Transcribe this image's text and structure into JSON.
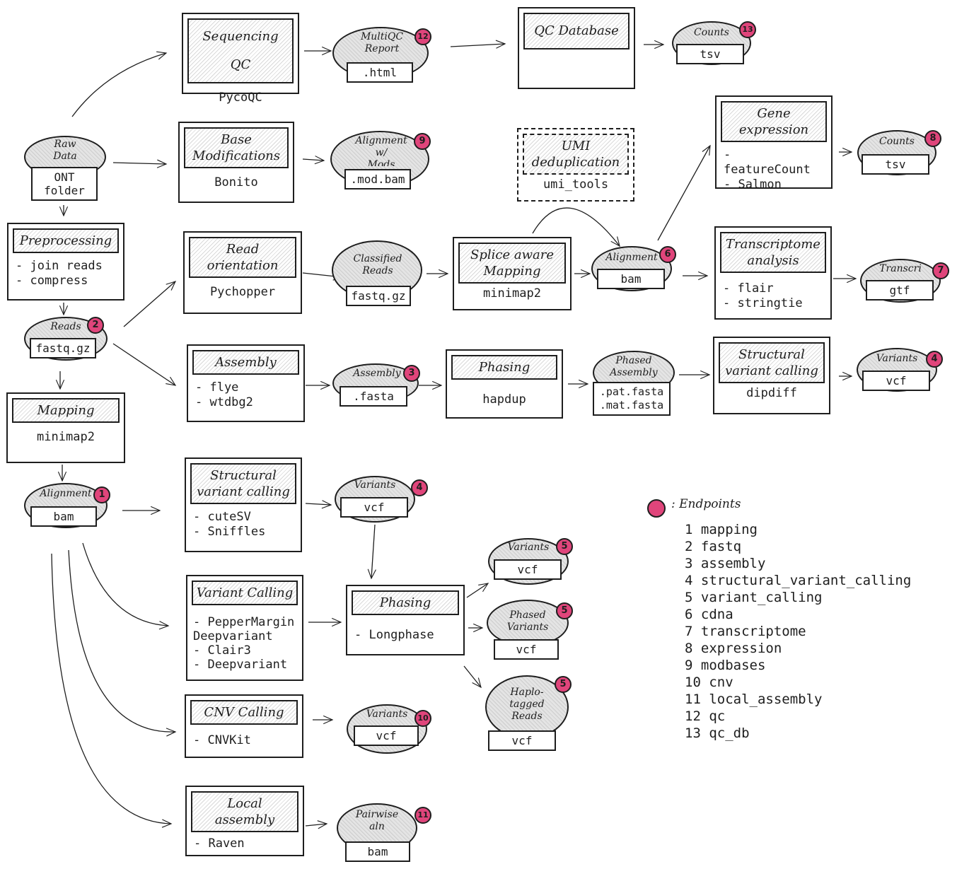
{
  "colors": {
    "endpoint": "#e0457b",
    "ink": "#1e1e1e"
  },
  "processes": [
    {
      "id": "sequencing-qc",
      "title": "Sequencing QC",
      "body": "PycoQC",
      "center": true
    },
    {
      "id": "base-modifications",
      "title": "Base\nModifications",
      "body": "Bonito",
      "center": true
    },
    {
      "id": "preprocessing",
      "title": "Preprocessing",
      "body": "- join reads\n- compress",
      "center": false
    },
    {
      "id": "read-orientation",
      "title": "Read\norientation",
      "body": "Pychopper",
      "center": true
    },
    {
      "id": "assembly",
      "title": "Assembly",
      "body": "- flye\n- wtdbg2",
      "center": false
    },
    {
      "id": "mapping",
      "title": "Mapping",
      "body": "minimap2",
      "center": true
    },
    {
      "id": "qc-database",
      "title": "QC Database",
      "body": "",
      "center": true
    },
    {
      "id": "umi-deduplication",
      "title": "UMI\ndeduplication",
      "body": "umi_tools",
      "center": true,
      "dashed": true
    },
    {
      "id": "splice-aware-mapping",
      "title": "Splice aware\nMapping",
      "body": "minimap2",
      "center": true
    },
    {
      "id": "gene-expression",
      "title": "Gene\nexpression",
      "body": "- featureCount\n- Salmon",
      "center": false
    },
    {
      "id": "transcriptome-analysis",
      "title": "Transcriptome\nanalysis",
      "body": "- flair\n- stringtie",
      "center": false
    },
    {
      "id": "phasing-assembly",
      "title": "Phasing",
      "body": "hapdup",
      "center": true
    },
    {
      "id": "structural-variant-calling-assembly",
      "title": "Structural\nvariant calling",
      "body": "dipdiff",
      "center": true
    },
    {
      "id": "structural-variant-calling",
      "title": "Structural\nvariant calling",
      "body": "- cuteSV\n- Sniffles",
      "center": false
    },
    {
      "id": "variant-calling",
      "title": "Variant Calling",
      "body": "- PepperMargin\nDeepvariant\n- Clair3\n- Deepvariant",
      "center": false
    },
    {
      "id": "phasing",
      "title": "Phasing",
      "body": "- Longphase",
      "center": false
    },
    {
      "id": "cnv-calling",
      "title": "CNV Calling",
      "body": "- CNVKit",
      "center": false
    },
    {
      "id": "local-assembly",
      "title": "Local\nassembly",
      "body": "- Raven",
      "center": false
    }
  ],
  "artifacts": [
    {
      "id": "raw-data",
      "label": "Raw\nData",
      "file": "ONT\nfolder",
      "badge": ""
    },
    {
      "id": "reads",
      "label": "Reads",
      "file": "fastq.gz",
      "badge": "2"
    },
    {
      "id": "alignment-main",
      "label": "Alignment",
      "file": "bam",
      "badge": "1"
    },
    {
      "id": "multiqc-report",
      "label": "MultiQC\nReport",
      "file": ".html",
      "badge": "12"
    },
    {
      "id": "alignment-modbases",
      "label": "Alignment\nw/\nMods",
      "file": ".mod.bam",
      "badge": "9"
    },
    {
      "id": "classified-reads",
      "label": "Classified\nReads",
      "file": "fastq.gz",
      "badge": ""
    },
    {
      "id": "assembly-fasta",
      "label": "Assembly",
      "file": ".fasta",
      "badge": "3"
    },
    {
      "id": "counts-qc",
      "label": "Counts",
      "file": "tsv",
      "badge": "13"
    },
    {
      "id": "alignment-cdna",
      "label": "Alignment",
      "file": "bam",
      "badge": "6"
    },
    {
      "id": "phased-assembly",
      "label": "Phased\nAssembly",
      "file": ".pat.fasta\n.mat.fasta",
      "badge": ""
    },
    {
      "id": "counts-expression",
      "label": "Counts",
      "file": "tsv",
      "badge": "8"
    },
    {
      "id": "transcripts",
      "label": "Transcri",
      "file": "gtf",
      "badge": "7"
    },
    {
      "id": "variants-assembly-sv",
      "label": "Variants",
      "file": "vcf",
      "badge": "4"
    },
    {
      "id": "variants-sv",
      "label": "Variants",
      "file": "vcf",
      "badge": "4"
    },
    {
      "id": "variants-snp",
      "label": "Variants",
      "file": "vcf",
      "badge": "5"
    },
    {
      "id": "phased-variants",
      "label": "Phased\nVariants",
      "file": "vcf",
      "badge": "5"
    },
    {
      "id": "haplotagged-reads",
      "label": "Haplo-\ntagged\nReads",
      "file": "vcf",
      "badge": "5"
    },
    {
      "id": "variants-cnv",
      "label": "Variants",
      "file": "vcf",
      "badge": "10"
    },
    {
      "id": "pairwise-aln",
      "label": "Pairwise\naln",
      "file": "bam",
      "badge": "11"
    }
  ],
  "legend": {
    "title": ": Endpoints",
    "items": [
      "1 mapping",
      "2 fastq",
      "3 assembly",
      "4 structural_variant_calling",
      "5 variant_calling",
      "6 cdna",
      "7 transcriptome",
      "8 expression",
      "9 modbases",
      "10 cnv",
      "11 local_assembly",
      "12 qc",
      "13 qc_db"
    ]
  }
}
